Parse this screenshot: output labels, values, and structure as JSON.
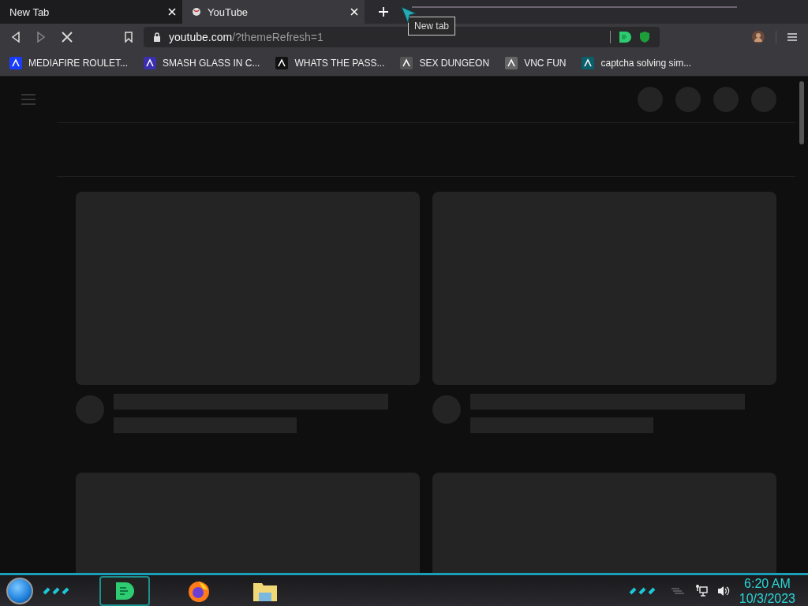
{
  "tabs": [
    {
      "title": "New Tab",
      "selected": false
    },
    {
      "title": "YouTube",
      "selected": true
    }
  ],
  "tooltip": "New tab",
  "toolbar": {
    "loading": true,
    "url_host": "youtube.com",
    "url_path": "/?themeRefresh=1"
  },
  "bookmarks": [
    {
      "label": "MEDIAFIRE ROULET..."
    },
    {
      "label": "SMASH GLASS IN C..."
    },
    {
      "label": "WHATS THE PASS..."
    },
    {
      "label": "SEX DUNGEON"
    },
    {
      "label": "VNC FUN"
    },
    {
      "label": "captcha solving sim..."
    }
  ],
  "clock": {
    "time": "6:20 AM",
    "date": "10/3/2023"
  }
}
